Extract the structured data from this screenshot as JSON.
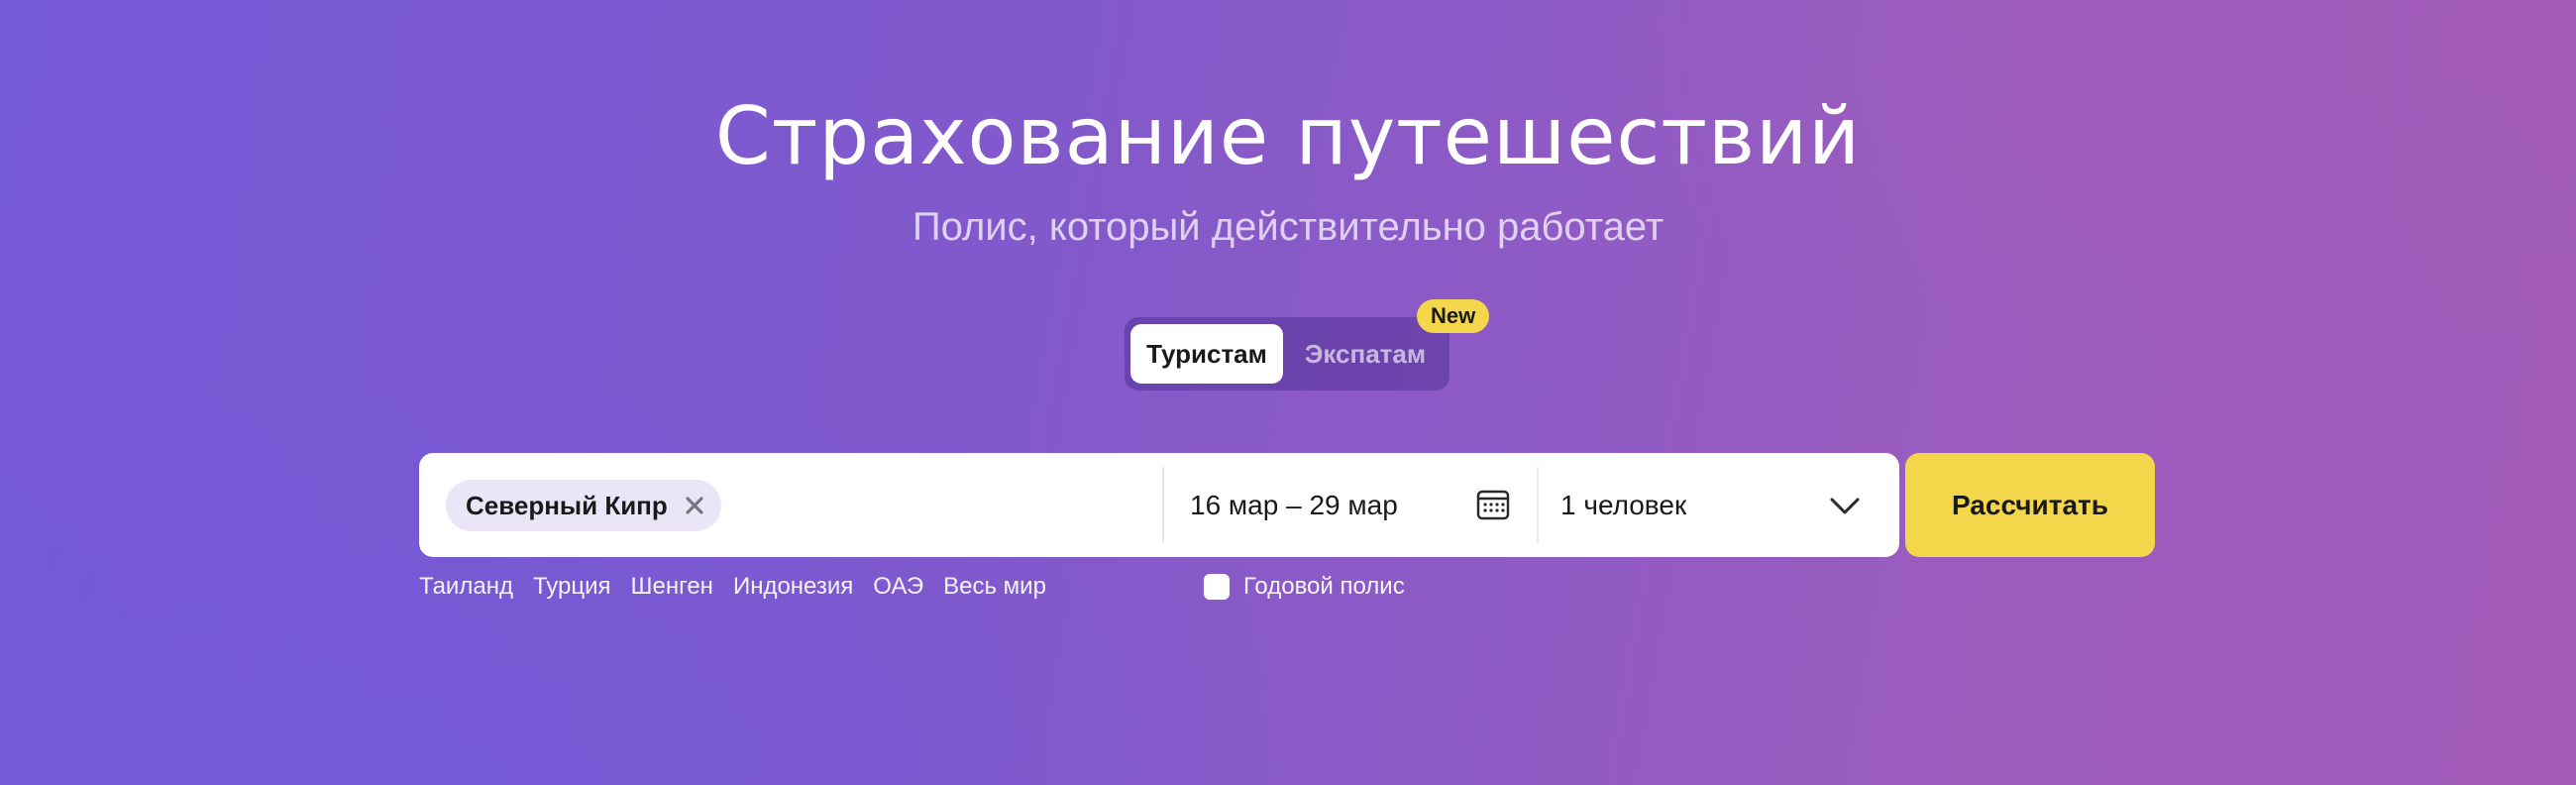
{
  "hero": {
    "title": "Страхование путешествий",
    "subtitle": "Полис, который действительно работает"
  },
  "tabs": {
    "items": [
      {
        "label": "Туристам",
        "active": true
      },
      {
        "label": "Экспатам",
        "active": false
      }
    ],
    "new_badge": "New"
  },
  "search": {
    "destination_chip": "Северный Кипр",
    "dates": "16 мар – 29 мар",
    "persons": "1 человек",
    "submit_label": "Рассчитать"
  },
  "quick_links": [
    "Таиланд",
    "Турция",
    "Шенген",
    "Индонезия",
    "ОАЭ",
    "Весь мир"
  ],
  "annual_policy": {
    "label": "Годовой полис",
    "checked": false
  },
  "icons": {
    "chip_close": "close-icon",
    "dates": "calendar-icon",
    "persons_dropdown": "chevron-down-icon"
  },
  "colors": {
    "accent_yellow": "#f3d64a",
    "background_start": "#7459d8",
    "background_end": "#a35bb8",
    "chip_background": "#ebe6f7"
  }
}
